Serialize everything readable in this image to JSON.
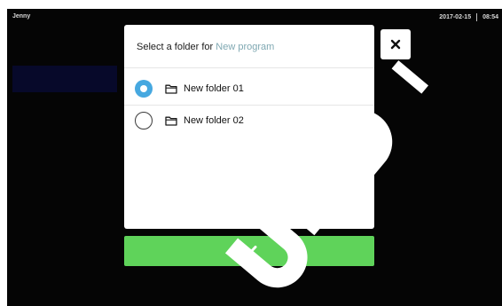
{
  "status_bar": {
    "user": "Jenny",
    "date": "2017-02-15",
    "time": "08:54"
  },
  "dialog": {
    "title_prefix": "Select a folder for",
    "title_accent": "New program",
    "folders": [
      {
        "label": "New folder 01",
        "selected": true
      },
      {
        "label": "New folder 02",
        "selected": false
      }
    ]
  },
  "icons": {
    "close": "close-icon",
    "confirm": "checkmark-icon",
    "folder": "folder-icon"
  },
  "colors": {
    "radio_selected": "#46a8e0",
    "confirm_button": "#5fd35a",
    "title_accent": "#7fa8b2",
    "screen_background": "#050505"
  }
}
